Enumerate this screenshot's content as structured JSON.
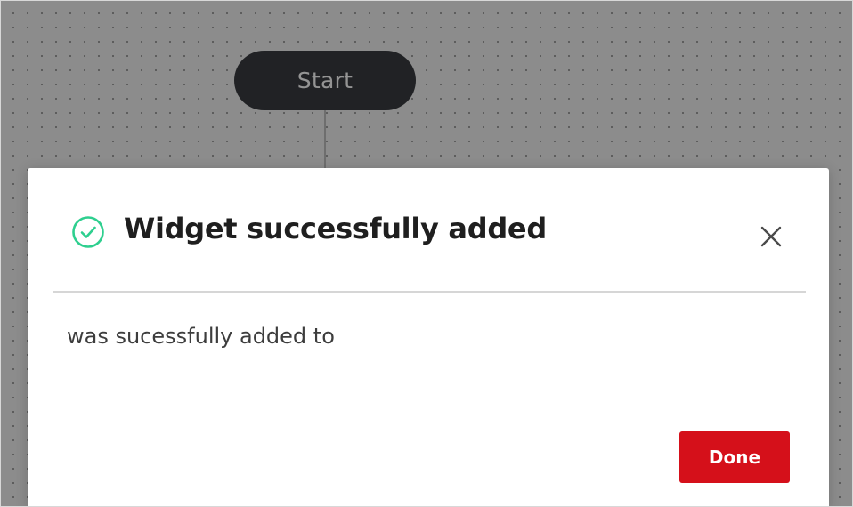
{
  "canvas": {
    "start_node_label": "Start"
  },
  "modal": {
    "title": "Widget successfully added",
    "body_text": "was sucessfully added to",
    "done_label": "Done",
    "close_icon": "close-icon",
    "status_icon": "check-circle-icon"
  },
  "colors": {
    "success": "#2ecf8f",
    "primary_button": "#d5101a",
    "node": "#3a3c40"
  }
}
